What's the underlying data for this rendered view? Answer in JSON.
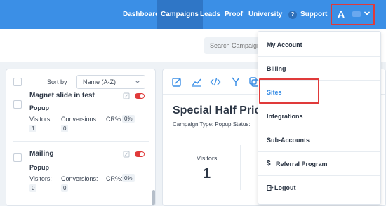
{
  "nav": {
    "items": [
      "Dashboard",
      "Campaigns",
      "Leads",
      "Proof",
      "University"
    ],
    "active": "Campaigns",
    "support_label": "Support",
    "help_glyph": "?",
    "avatar_letter": "A",
    "brand_color": "#3b8fe6"
  },
  "search": {
    "placeholder": "Search Campaigns"
  },
  "campaign_list": {
    "sort_label": "Sort by",
    "sort_value": "Name (A-Z)",
    "items": [
      {
        "name": "Magnet slide in test",
        "type": "Popup",
        "visitors_label": "Visitors:",
        "visitors": "1",
        "conversions_label": "Conversions:",
        "conversions": "0",
        "cr_label": "CR%:",
        "cr": "0%"
      },
      {
        "name": "Mailing",
        "type": "Popup",
        "visitors_label": "Visitors:",
        "visitors": "0",
        "conversions_label": "Conversions:",
        "conversions": "0",
        "cr_label": "CR%:",
        "cr": "0%"
      }
    ]
  },
  "detail": {
    "title": "Special Half Price",
    "meta": "Campaign Type: Popup   Status:",
    "visitors_label": "Visitors",
    "visitors_value": "1"
  },
  "account_menu": {
    "items": [
      {
        "label": "My Account",
        "icon": ""
      },
      {
        "label": "Billing",
        "icon": ""
      },
      {
        "label": "Sites",
        "icon": ""
      },
      {
        "label": "Integrations",
        "icon": ""
      },
      {
        "label": "Sub-Accounts",
        "icon": ""
      },
      {
        "label": "Referral Program",
        "icon": "dollar-icon"
      },
      {
        "label": "Logout",
        "icon": "logout-icon"
      }
    ],
    "highlight_color": "#e03a3a"
  }
}
